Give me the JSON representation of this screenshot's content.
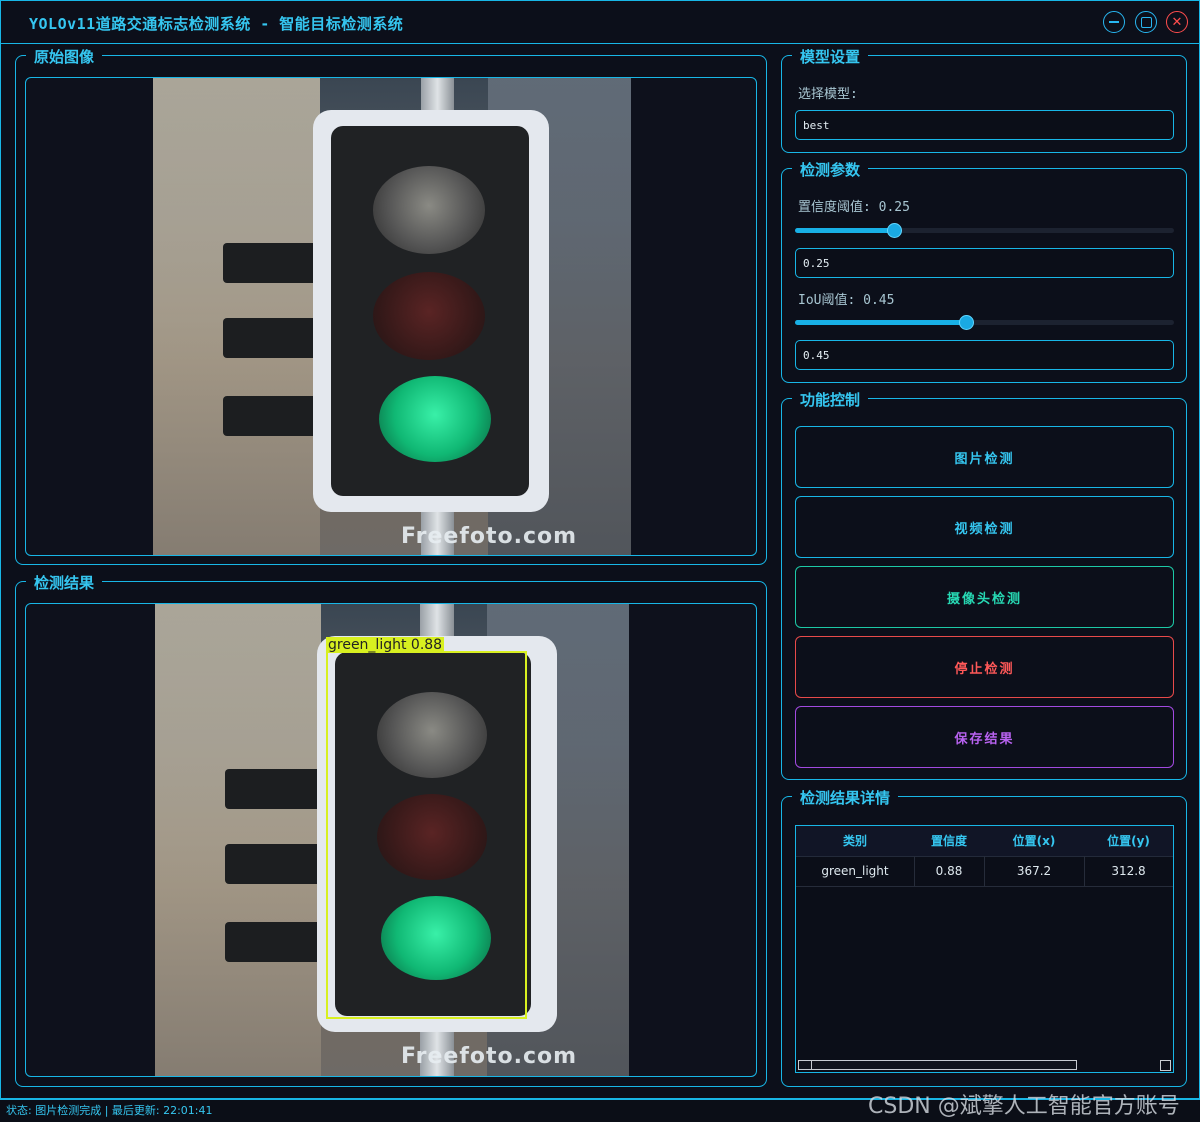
{
  "window": {
    "title": "YOLOv11道路交通标志检测系统 - 智能目标检测系统",
    "controls": [
      "minimize",
      "maximize",
      "close"
    ]
  },
  "original_panel": {
    "title": "原始图像",
    "image_watermark": "Freefoto.com"
  },
  "result_panel": {
    "title": "检测结果",
    "image_watermark": "Freefoto.com",
    "detection_label": "green_light  0.88"
  },
  "model_settings": {
    "title": "模型设置",
    "select_label": "选择模型:",
    "model_value": "best"
  },
  "detect_params": {
    "title": "检测参数",
    "confidence_label": "置信度阈值: 0.25",
    "confidence_value": "0.25",
    "confidence_level": 0.25,
    "iou_label": "IoU阈值: 0.45",
    "iou_value": "0.45",
    "iou_level": 0.45
  },
  "function_control": {
    "title": "功能控制",
    "buttons": {
      "image_detect": "图片检测",
      "video_detect": "视频检测",
      "camera_detect": "摄像头检测",
      "stop_detect": "停止检测",
      "save_result": "保存结果"
    }
  },
  "result_details": {
    "title": "检测结果详情",
    "columns": [
      "类别",
      "置信度",
      "位置(x)",
      "位置(y)"
    ],
    "rows": [
      [
        "green_light",
        "0.88",
        "367.2",
        "312.8"
      ]
    ]
  },
  "status_bar": {
    "text": "状态: 图片检测完成 | 最后更新: 22:01:41"
  },
  "watermark": "CSDN @斌擎人工智能官方账号",
  "colors": {
    "accent": "#18b6e6",
    "title_text": "#35c6f0",
    "teal": "#27d9b4",
    "red": "#ff5858",
    "purple": "#b862f0",
    "bbox": "#d8f020"
  }
}
